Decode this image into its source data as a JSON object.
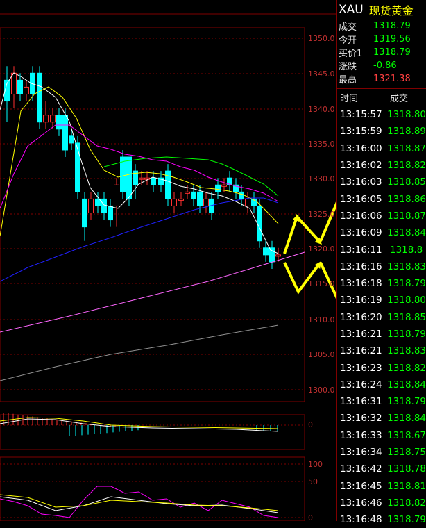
{
  "quote": {
    "symbol": "XAU",
    "name": "现货黄金",
    "rows": [
      {
        "label": "成交",
        "value": "1318.79",
        "color": "#00ff00"
      },
      {
        "label": "今开",
        "value": "1319.56",
        "color": "#00ff00"
      },
      {
        "label": "买价1",
        "value": "1318.79",
        "color": "#00ff00"
      },
      {
        "label": "涨跌",
        "value": "-0.86",
        "color": "#00ff00"
      },
      {
        "label": "最高",
        "value": "1321.38",
        "color": "#ff4040"
      }
    ],
    "ticks_header": {
      "time": "时间",
      "trade": "成交"
    },
    "ticks": [
      {
        "time": "13:15:57",
        "price": "1318.80"
      },
      {
        "time": "13:15:59",
        "price": "1318.89"
      },
      {
        "time": "13:16:00",
        "price": "1318.87"
      },
      {
        "time": "13:16:02",
        "price": "1318.82"
      },
      {
        "time": "13:16:03",
        "price": "1318.85"
      },
      {
        "time": "13:16:05",
        "price": "1318.86"
      },
      {
        "time": "13:16:06",
        "price": "1318.87"
      },
      {
        "time": "13:16:09",
        "price": "1318.84"
      },
      {
        "time": "13:16:11",
        "price": "1318.8"
      },
      {
        "time": "13:16:16",
        "price": "1318.83"
      },
      {
        "time": "13:16:18",
        "price": "1318.79"
      },
      {
        "time": "13:16:19",
        "price": "1318.80"
      },
      {
        "time": "13:16:20",
        "price": "1318.85"
      },
      {
        "time": "13:16:21",
        "price": "1318.79"
      },
      {
        "time": "13:16:21",
        "price": "1318.83"
      },
      {
        "time": "13:16:23",
        "price": "1318.82"
      },
      {
        "time": "13:16:24",
        "price": "1318.84"
      },
      {
        "time": "13:16:31",
        "price": "1318.79"
      },
      {
        "time": "13:16:32",
        "price": "1318.84"
      },
      {
        "time": "13:16:33",
        "price": "1318.67"
      },
      {
        "time": "13:16:34",
        "price": "1318.75"
      },
      {
        "time": "13:16:42",
        "price": "1318.78"
      },
      {
        "time": "13:16:45",
        "price": "1318.81"
      },
      {
        "time": "13:16:46",
        "price": "1318.82"
      },
      {
        "time": "13:16:48",
        "price": "1318.79"
      }
    ]
  },
  "chart": {
    "price_axis_labels": [
      "1350.0",
      "1345.0",
      "1340.0",
      "1335.0",
      "1330.0",
      "1325.0",
      "1320.0",
      "1315.0",
      "1310.0",
      "1305.0",
      "1300.0"
    ],
    "macd_axis_label": "0",
    "kdj_axis_labels": [
      "100",
      "50",
      "0"
    ]
  },
  "colors": {
    "up": "#ff3030",
    "down": "#00ffff",
    "grid": "#800000",
    "arrow": "#ffff00",
    "ma5": "#ffffff",
    "ma10": "#ffff00",
    "ma20": "#ff00ff",
    "ma30": "#00ff00",
    "ma60": "#2020ff",
    "ma_long": "#ff66ff",
    "ma_longer": "#909090"
  }
}
